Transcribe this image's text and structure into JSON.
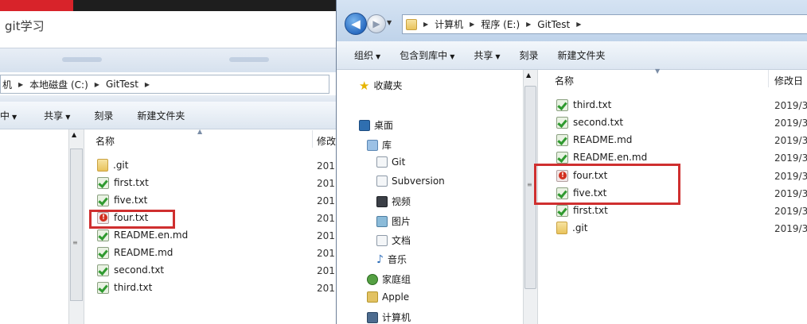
{
  "left": {
    "title": "git学习",
    "address": [
      "机",
      "本地磁盘 (C:)",
      "GitTest"
    ],
    "toolbar": [
      "中",
      "共享",
      "刻录",
      "新建文件夹"
    ],
    "columns": {
      "name": "名称",
      "modified": "修改"
    },
    "files": [
      {
        "name": ".git",
        "icon": "folder-icon",
        "date": "201"
      },
      {
        "name": "first.txt",
        "icon": "git-ok-icon",
        "date": "201"
      },
      {
        "name": "five.txt",
        "icon": "git-ok-icon",
        "date": "201"
      },
      {
        "name": "four.txt",
        "icon": "git-modified-icon",
        "date": "201"
      },
      {
        "name": "README.en.md",
        "icon": "git-ok-icon",
        "date": "201"
      },
      {
        "name": "README.md",
        "icon": "git-ok-icon",
        "date": "201"
      },
      {
        "name": "second.txt",
        "icon": "git-ok-icon",
        "date": "201"
      },
      {
        "name": "third.txt",
        "icon": "git-ok-icon",
        "date": "201"
      }
    ]
  },
  "right": {
    "address": [
      "计算机",
      "程序 (E:)",
      "GitTest"
    ],
    "toolbar": [
      "组织",
      "包含到库中",
      "共享",
      "刻录",
      "新建文件夹"
    ],
    "nav": [
      "收藏夹",
      "桌面",
      "库",
      "Git",
      "Subversion",
      "视频",
      "图片",
      "文档",
      "音乐",
      "家庭组",
      "Apple",
      "计算机"
    ],
    "columns": {
      "name": "名称",
      "modified": "修改日"
    },
    "files": [
      {
        "name": "third.txt",
        "icon": "git-ok-icon",
        "date": "2019/3"
      },
      {
        "name": "second.txt",
        "icon": "git-ok-icon",
        "date": "2019/3"
      },
      {
        "name": "README.md",
        "icon": "git-ok-icon",
        "date": "2019/3"
      },
      {
        "name": "README.en.md",
        "icon": "git-ok-icon",
        "date": "2019/3"
      },
      {
        "name": "four.txt",
        "icon": "git-modified-icon",
        "date": "2019/3"
      },
      {
        "name": "five.txt",
        "icon": "git-ok-icon",
        "date": "2019/3"
      },
      {
        "name": "first.txt",
        "icon": "git-ok-icon",
        "date": "2019/3"
      },
      {
        "name": ".git",
        "icon": "folder-icon",
        "date": "2019/3"
      }
    ]
  },
  "colors": {
    "highlight": "#cf2f2f",
    "git_ok": "#2f9a2f",
    "git_modified": "#d2301f"
  }
}
